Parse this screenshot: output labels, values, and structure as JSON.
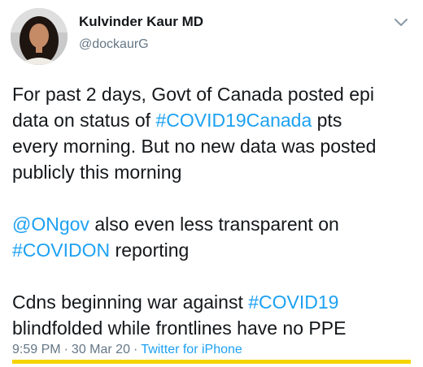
{
  "author": {
    "name": "Kulvinder Kaur MD",
    "handle": "@dockaurG"
  },
  "menu": {
    "icon": "chevron-down-icon"
  },
  "tweet": {
    "p1": {
      "l1": "For past 2 days, Govt of Canada posted epi",
      "l2_a": "data on status of ",
      "l2_tag": "#COVID19Canada",
      "l2_b": " pts",
      "l3": "every morning. But no new data was posted",
      "l4": "publicly this morning"
    },
    "p2": {
      "l1_mention": "@ONgov",
      "l1_b": " also even less transparent on",
      "l2_tag": "#COVIDON",
      "l2_b": " reporting"
    },
    "p3": {
      "l1_a": "Cdns beginning war against ",
      "l1_tag": "#COVID19",
      "l2": "blindfolded while frontlines have no PPE"
    }
  },
  "meta": {
    "time": "9:59 PM",
    "separator": "·",
    "date": "30 Mar 20",
    "source": "Twitter for iPhone"
  },
  "colors": {
    "link": "#1da1f2",
    "muted": "#657786",
    "text": "#14171a",
    "highlight": "#f5d400"
  }
}
